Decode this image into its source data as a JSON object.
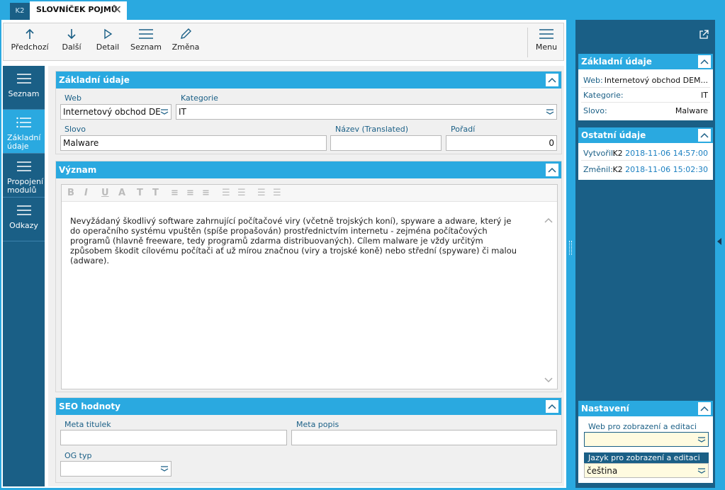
{
  "tabs": {
    "small": "K2",
    "active": "SLOVNÍČEK POJMŮ",
    "close": "✕"
  },
  "toolbar": {
    "prev": "Předchozí",
    "next": "Další",
    "detail": "Detail",
    "list": "Seznam",
    "edit": "Změna",
    "menu": "Menu"
  },
  "nav": [
    {
      "label": "Seznam"
    },
    {
      "label": "Základní údaje"
    },
    {
      "label": "Propojení modulů"
    },
    {
      "label": "Odkazy"
    }
  ],
  "basic": {
    "title": "Základní údaje",
    "web_label": "Web",
    "web_value": "Internetový obchod DE",
    "category_label": "Kategorie",
    "category_value": "IT",
    "word_label": "Slovo",
    "word_value": "Malware",
    "translated_label": "Název (Translated)",
    "translated_value": "",
    "order_label": "Pořadí",
    "order_value": "0"
  },
  "meaning": {
    "title": "Význam",
    "text": "Nevyžádaný škodlivý software zahrnující počítačové viry (včetně trojských koní), spyware a adware, který je do operačního systému vpuštěn (spíše propašován) prostřednictvím internetu - zejména počítačových programů (hlavně freeware, tedy programů zdarma distribuovaných). Cílem malware je vždy určitým způsobem škodit cílovému počítači ať už mírou značnou (viry a trojské koně) nebo střední (spyware) či malou (adware)."
  },
  "seo": {
    "title": "SEO hodnoty",
    "meta_title_label": "Meta titulek",
    "meta_desc_label": "Meta popis",
    "og_label": "OG typ"
  },
  "right": {
    "basic_title": "Základní údaje",
    "web_label": "Web:",
    "web_value": "Internetový obchod DEM...",
    "cat_label": "Kategorie:",
    "cat_value": "IT",
    "word_label": "Slovo:",
    "word_value": "Malware",
    "other_title": "Ostatní údaje",
    "created_label": "Vytvořil:",
    "created_user": "K2",
    "created_date": "2018-11-06 14:57:00",
    "changed_label": "Změnil:",
    "changed_user": "K2",
    "changed_date": "2018-11-06 15:02:30",
    "settings_title": "Nastavení",
    "web_edit_label": "Web pro zobrazení a editaci",
    "web_edit_value": "",
    "lang_label": "Jazyk pro zobrazení a editaci",
    "lang_value": "čeština"
  },
  "colors": {
    "accent": "#2aa9e0",
    "dark": "#1a5f86",
    "link": "#1a5f86",
    "date": "#1a7fc0"
  }
}
